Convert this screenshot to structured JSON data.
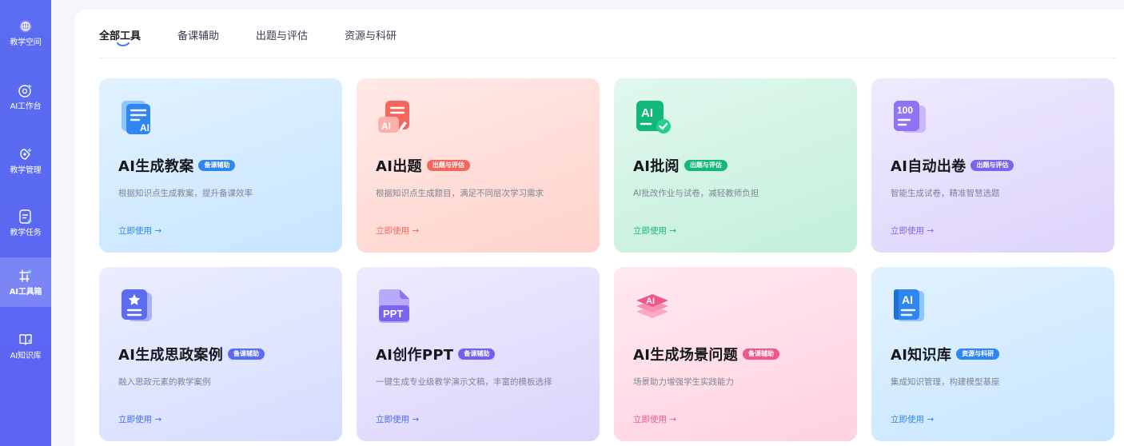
{
  "sidebar": {
    "items": [
      {
        "label": "教学空间",
        "icon": "globe-icon",
        "active": false
      },
      {
        "label": "AI工作台",
        "icon": "ai-workbench-icon",
        "active": false
      },
      {
        "label": "教学管理",
        "icon": "teaching-manage-icon",
        "active": false
      },
      {
        "label": "教学任务",
        "icon": "task-icon",
        "active": false
      },
      {
        "label": "AI工具箱",
        "icon": "toolbox-icon",
        "active": true
      },
      {
        "label": "AI知识库",
        "icon": "knowledge-book-icon",
        "active": false
      }
    ]
  },
  "tabs": [
    {
      "label": "全部工具",
      "active": true
    },
    {
      "label": "备课辅助",
      "active": false
    },
    {
      "label": "出题与评估",
      "active": false
    },
    {
      "label": "资源与科研",
      "active": false
    }
  ],
  "cards": [
    {
      "title": "AI生成教案",
      "badge": "备课辅助",
      "desc": "根据知识点生成教案，提升备课效率",
      "link": "立即使用 →",
      "icon": "lesson-plan-icon",
      "accent": "#2f86f0"
    },
    {
      "title": "AI出题",
      "badge": "出题与评估",
      "desc": "根据知识点生成题目，满足不同层次学习需求",
      "link": "立即使用 →",
      "icon": "question-edit-icon",
      "accent": "#f5675d"
    },
    {
      "title": "AI批阅",
      "badge": "出题与评估",
      "desc": "AI批改作业与试卷，减轻教师负担",
      "link": "立即使用 →",
      "icon": "review-check-icon",
      "accent": "#12b77a"
    },
    {
      "title": "AI自动出卷",
      "badge": "出题与评估",
      "desc": "智能生成试卷，精准智慧选题",
      "link": "立即使用 →",
      "icon": "exam-100-icon",
      "accent": "#7d64ef"
    },
    {
      "title": "AI生成思政案例",
      "badge": "备课辅助",
      "desc": "融入思政元素的教学案例",
      "link": "立即使用 →",
      "icon": "star-doc-icon",
      "accent": "#5b6cf0"
    },
    {
      "title": "AI创作PPT",
      "badge": "备课辅助",
      "desc": "一键生成专业级教学演示文稿，丰富的模板选择",
      "link": "立即使用 →",
      "icon": "ppt-icon",
      "accent": "#6f61ee"
    },
    {
      "title": "AI生成场景问题",
      "badge": "备课辅助",
      "desc": "场景助力增强学生实践能力",
      "link": "立即使用 →",
      "icon": "layers-ai-icon",
      "accent": "#f0578f"
    },
    {
      "title": "AI知识库",
      "badge": "资源与科研",
      "desc": "集成知识管理，构建模型基座",
      "link": "立即使用 →",
      "icon": "ai-book-icon",
      "accent": "#2f86f0"
    }
  ],
  "colors": {
    "sidebar": "#5b6cf0",
    "card_blue": "#dcefff",
    "card_red": "#ffe1dc",
    "card_green": "#d9f6e8",
    "card_purple": "#ebe6fd",
    "card_pink": "#ffe1ea"
  }
}
